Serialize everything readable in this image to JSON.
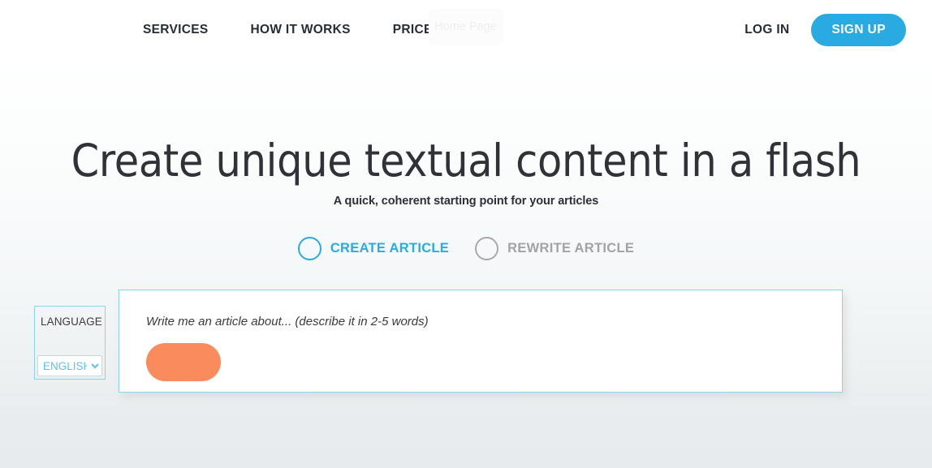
{
  "nav": {
    "links": [
      {
        "label": "SERVICES",
        "name": "nav-link-services"
      },
      {
        "label": "HOW IT WORKS",
        "name": "nav-link-how-it-works"
      },
      {
        "label": "PRICE LIST",
        "name": "nav-link-price-list"
      }
    ],
    "login_label": "LOG IN",
    "signup_label": "SIGN UP",
    "signup_color": "#29abe2"
  },
  "tooltip": {
    "label": "Home Page"
  },
  "hero": {
    "title": "Create unique textual content in a flash",
    "subtitle": "A quick, coherent starting point for your articles"
  },
  "mode_selector": {
    "options": [
      {
        "label": "CREATE ARTICLE",
        "state": "selected",
        "color": "#29abe2"
      },
      {
        "label": "REWRITE ARTICLE",
        "state": "unselected",
        "color": "#a3a3a3"
      }
    ]
  },
  "language": {
    "label": "LANGUAGE",
    "selected": "ENGLISH",
    "options": [
      "ENGLISH"
    ],
    "accent_color": "#5cc0ea"
  },
  "input_card": {
    "placeholder": "Write me an article about... (describe it in 2-5 words)",
    "value": "",
    "border_color": "#8ed3ee",
    "generate_label": "",
    "generate_color": "#f98b5c"
  }
}
